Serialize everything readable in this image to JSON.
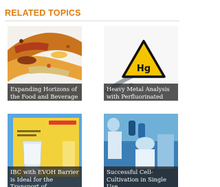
{
  "section": {
    "title": "RELATED TOPICS"
  },
  "cards": [
    {
      "caption": "Expanding Horizons of the Food and Beverage",
      "image": "spices-image"
    },
    {
      "caption": "Heavy Metal Analysis with Perfluorinated",
      "image": "mercury-hazard-image"
    },
    {
      "caption": "IBC with EVOH Barrier is Ideal for the Transport of",
      "image": "brochure-image"
    },
    {
      "caption": "Successful Cell-Cultivation in Single Use",
      "image": "lab-image"
    }
  ],
  "colors": {
    "accent": "#e07b10",
    "caption_bg": "#282828"
  }
}
